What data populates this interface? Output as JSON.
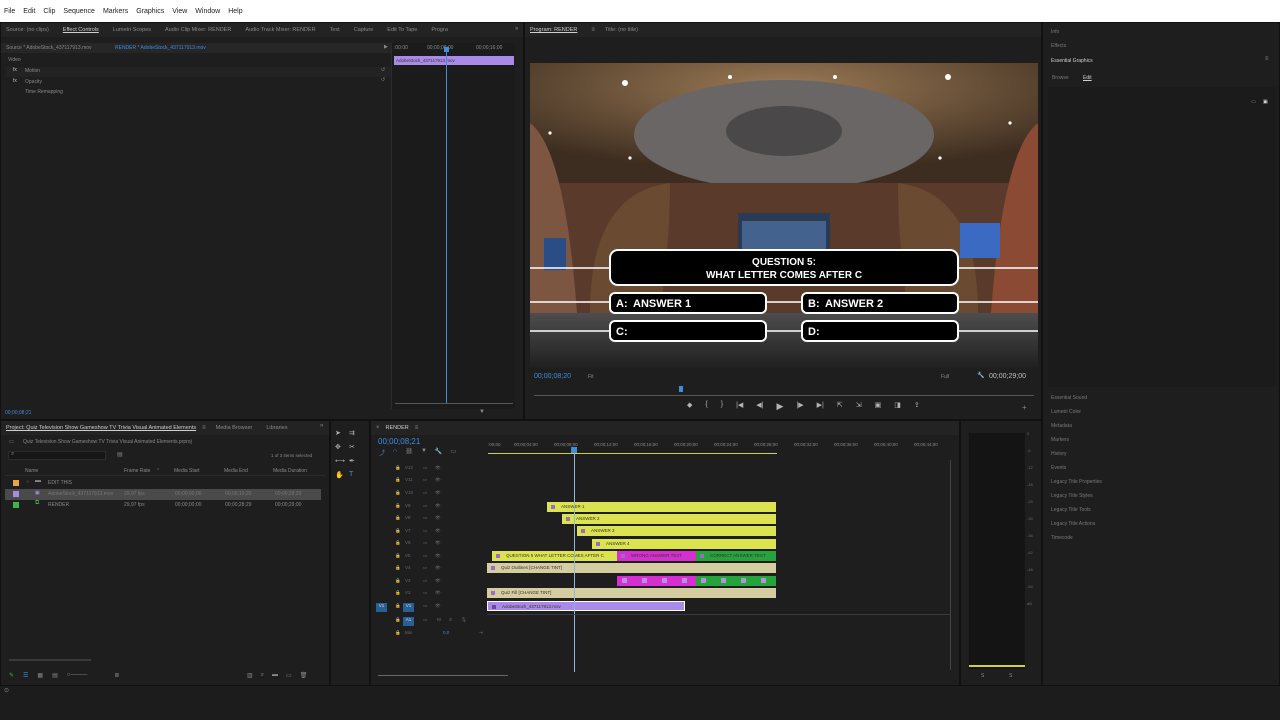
{
  "menu": [
    "File",
    "Edit",
    "Clip",
    "Sequence",
    "Markers",
    "Graphics",
    "View",
    "Window",
    "Help"
  ],
  "source_tabs": [
    "Source: (no clips)",
    "Effect Controls",
    "Lumetri Scopes",
    "Audio Clip Mixer: RENDER",
    "Audio Track Mixer: RENDER",
    "Text",
    "Capture",
    "Edit To Tape",
    "Progra"
  ],
  "effect_controls": {
    "source_label": "Source * AdobeStock_437117913.mov",
    "sequence_label": "RENDER * AdobeStock_437117913.mov",
    "section": "Video",
    "effects": [
      "Motion",
      "Opacity",
      "Time Remapping"
    ],
    "mini_ruler": [
      ":00:00",
      "00;00;08;00",
      "00;00;16;00"
    ],
    "mini_clip": "AdobeStock_437117913.mov",
    "timecode": "00;00;08;21"
  },
  "program": {
    "tab": "Program: RENDER",
    "title_tab": "Title: (no title)",
    "question_line1": "QUESTION 5:",
    "question_line2": "WHAT LETTER COMES AFTER C",
    "answers": [
      {
        "letter": "A:",
        "text": "ANSWER 1"
      },
      {
        "letter": "B:",
        "text": "ANSWER 2"
      },
      {
        "letter": "C:",
        "text": ""
      },
      {
        "letter": "D:",
        "text": ""
      }
    ],
    "timecode": "00;00;08;20",
    "fit": "Fit",
    "quality": "Full",
    "duration": "00;00;29;00"
  },
  "project": {
    "tabs": [
      "Project: Quiz Television Show Gameshow TV Trivia Visual Animated Elements",
      "Media Browser",
      "Libraries"
    ],
    "path": "Quiz Television Show Gameshow TV Trivia Visual Animated Elements.prproj",
    "selection": "1 of 3 items selected",
    "columns": [
      "Name",
      "Frame Rate",
      "Media Start",
      "Media End",
      "Media Duration"
    ],
    "rows": [
      {
        "name": "EDIT THIS",
        "fps": "",
        "start": "",
        "end": "",
        "dur": "",
        "color": "#e8a24a"
      },
      {
        "name": "AdobeStock_437117913.mov",
        "fps": "29,97 fps",
        "start": "00;00;00;00",
        "end": "00;00;19;20",
        "dur": "00;00;28;29",
        "color": "#a98ae6"
      },
      {
        "name": "RENDER",
        "fps": "29,97 fps",
        "start": "00;00;00;00",
        "end": "00;00;28;29",
        "dur": "00;00;29;00",
        "color": "#3fb34f"
      }
    ]
  },
  "timeline": {
    "tab": "RENDER",
    "timecode": "00;00;08;21",
    "ruler": [
      ":00;00",
      "00;00;04;00",
      "00;00;08;00",
      "00;00;12;00",
      "00;00;16;00",
      "00;00;20;00",
      "00;00;24;00",
      "00;00;28;00",
      "00;00;32;00",
      "00;00;36;00",
      "00;00;40;00",
      "00;00;44;00"
    ],
    "tracks": [
      "V12",
      "V11",
      "V10",
      "V9",
      "V8",
      "V7",
      "V6",
      "V5",
      "V4",
      "V3",
      "V2",
      "V1",
      "A1",
      "Mix"
    ],
    "mix_value": "0,0",
    "clips": {
      "answer1": "ANSWER 1",
      "answer2": "ANSWER 2",
      "answer3": "ANSWER 3",
      "answer4": "ANSWER 4",
      "question": "QUESTION 5 WHAT LETTER COMES AFTER C",
      "wrong": "WRONG ANSWER TEXT",
      "correct": "CORRECT ANSWER TEXT",
      "outlines": "Quiz Outlines [CHANGE TINT]",
      "fill": "Quiz Fill [CHANGE TINT]",
      "video": "AdobeStock_437117913.mov"
    }
  },
  "right_panel": {
    "top": [
      "Info",
      "Effects",
      "Essential Graphics"
    ],
    "eg_tabs": [
      "Browse",
      "Edit"
    ],
    "bottom": [
      "Essential Sound",
      "Lumetri Color",
      "Metadata",
      "Markers",
      "History",
      "Events",
      "Legacy Title Properties",
      "Legacy Title Styles",
      "Legacy Title Tools",
      "Legacy Title Actions",
      "Timecode"
    ]
  },
  "meter": {
    "scale": [
      "0",
      "-6",
      "-12",
      "-18",
      "-24",
      "-30",
      "-36",
      "-42",
      "-48",
      "-54",
      "dB"
    ],
    "solo": [
      "S",
      "S"
    ]
  }
}
